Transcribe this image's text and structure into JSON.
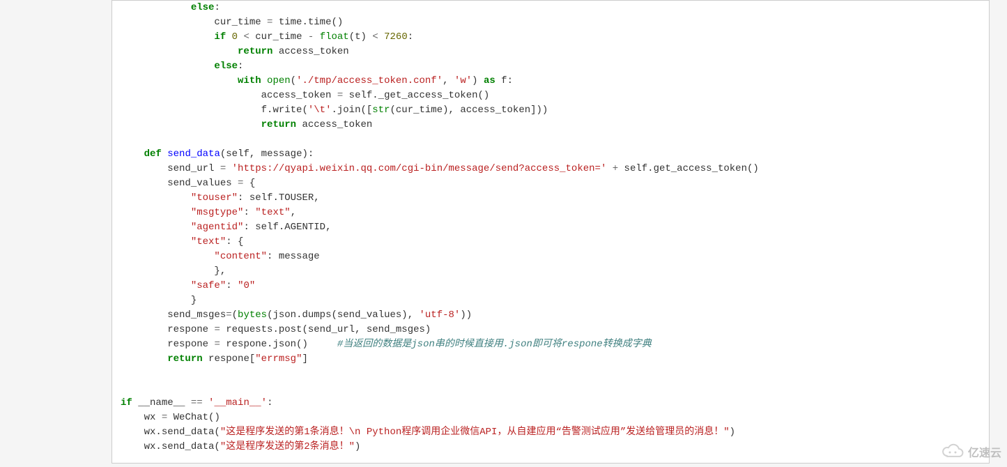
{
  "code": {
    "lines": [
      {
        "indent": 12,
        "segments": [
          {
            "t": "else",
            "c": "kw"
          },
          {
            "t": ":"
          }
        ]
      },
      {
        "indent": 16,
        "segments": [
          {
            "t": "cur_time "
          },
          {
            "t": "=",
            "c": "op"
          },
          {
            "t": " time.time()"
          }
        ]
      },
      {
        "indent": 16,
        "segments": [
          {
            "t": "if",
            "c": "kw"
          },
          {
            "t": " "
          },
          {
            "t": "0",
            "c": "num"
          },
          {
            "t": " "
          },
          {
            "t": "<",
            "c": "op"
          },
          {
            "t": " cur_time "
          },
          {
            "t": "-",
            "c": "op"
          },
          {
            "t": " "
          },
          {
            "t": "float",
            "c": "nm"
          },
          {
            "t": "(t) "
          },
          {
            "t": "<",
            "c": "op"
          },
          {
            "t": " "
          },
          {
            "t": "7260",
            "c": "num"
          },
          {
            "t": ":"
          }
        ]
      },
      {
        "indent": 20,
        "segments": [
          {
            "t": "return",
            "c": "kw"
          },
          {
            "t": " access_token"
          }
        ]
      },
      {
        "indent": 16,
        "segments": [
          {
            "t": "else",
            "c": "kw"
          },
          {
            "t": ":"
          }
        ]
      },
      {
        "indent": 20,
        "segments": [
          {
            "t": "with",
            "c": "kw"
          },
          {
            "t": " "
          },
          {
            "t": "open",
            "c": "nm"
          },
          {
            "t": "("
          },
          {
            "t": "'./tmp/access_token.conf'",
            "c": "strb"
          },
          {
            "t": ", "
          },
          {
            "t": "'w'",
            "c": "strb"
          },
          {
            "t": ") "
          },
          {
            "t": "as",
            "c": "kw"
          },
          {
            "t": " f:"
          }
        ]
      },
      {
        "indent": 24,
        "segments": [
          {
            "t": "access_token "
          },
          {
            "t": "=",
            "c": "op"
          },
          {
            "t": " self._get_access_token()"
          }
        ]
      },
      {
        "indent": 24,
        "segments": [
          {
            "t": "f.write("
          },
          {
            "t": "'\\t'",
            "c": "strb"
          },
          {
            "t": ".join(["
          },
          {
            "t": "str",
            "c": "nm"
          },
          {
            "t": "(cur_time), access_token]))"
          }
        ]
      },
      {
        "indent": 24,
        "segments": [
          {
            "t": "return",
            "c": "kw"
          },
          {
            "t": " access_token"
          }
        ]
      },
      {
        "indent": 0,
        "segments": []
      },
      {
        "indent": 4,
        "segments": [
          {
            "t": "def",
            "c": "kw"
          },
          {
            "t": " "
          },
          {
            "t": "send_data",
            "c": "fn"
          },
          {
            "t": "(self, message):"
          }
        ]
      },
      {
        "indent": 8,
        "segments": [
          {
            "t": "send_url "
          },
          {
            "t": "=",
            "c": "op"
          },
          {
            "t": " "
          },
          {
            "t": "'https://qyapi.weixin.qq.com/cgi-bin/message/send?access_token='",
            "c": "strb"
          },
          {
            "t": " "
          },
          {
            "t": "+",
            "c": "op"
          },
          {
            "t": " self.get_access_token()"
          }
        ]
      },
      {
        "indent": 8,
        "segments": [
          {
            "t": "send_values "
          },
          {
            "t": "=",
            "c": "op"
          },
          {
            "t": " {"
          }
        ]
      },
      {
        "indent": 12,
        "segments": [
          {
            "t": "\"touser\"",
            "c": "strb"
          },
          {
            "t": ": self.TOUSER,"
          }
        ]
      },
      {
        "indent": 12,
        "segments": [
          {
            "t": "\"msgtype\"",
            "c": "strb"
          },
          {
            "t": ": "
          },
          {
            "t": "\"text\"",
            "c": "strb"
          },
          {
            "t": ","
          }
        ]
      },
      {
        "indent": 12,
        "segments": [
          {
            "t": "\"agentid\"",
            "c": "strb"
          },
          {
            "t": ": self.AGENTID,"
          }
        ]
      },
      {
        "indent": 12,
        "segments": [
          {
            "t": "\"text\"",
            "c": "strb"
          },
          {
            "t": ": {"
          }
        ]
      },
      {
        "indent": 16,
        "segments": [
          {
            "t": "\"content\"",
            "c": "strb"
          },
          {
            "t": ": message"
          }
        ]
      },
      {
        "indent": 16,
        "segments": [
          {
            "t": "},"
          }
        ]
      },
      {
        "indent": 12,
        "segments": [
          {
            "t": "\"safe\"",
            "c": "strb"
          },
          {
            "t": ": "
          },
          {
            "t": "\"0\"",
            "c": "strb"
          }
        ]
      },
      {
        "indent": 12,
        "segments": [
          {
            "t": "}"
          }
        ]
      },
      {
        "indent": 8,
        "segments": [
          {
            "t": "send_msges"
          },
          {
            "t": "=",
            "c": "op"
          },
          {
            "t": "("
          },
          {
            "t": "bytes",
            "c": "nm"
          },
          {
            "t": "(json.dumps(send_values), "
          },
          {
            "t": "'utf-8'",
            "c": "strb"
          },
          {
            "t": "))"
          }
        ]
      },
      {
        "indent": 8,
        "segments": [
          {
            "t": "respone "
          },
          {
            "t": "=",
            "c": "op"
          },
          {
            "t": " requests.post(send_url, send_msges)"
          }
        ]
      },
      {
        "indent": 8,
        "segments": [
          {
            "t": "respone "
          },
          {
            "t": "=",
            "c": "op"
          },
          {
            "t": " respone.json()     "
          },
          {
            "t": "#当返回的数据是json串的时候直接用.json即可将respone转换成字典",
            "c": "com"
          }
        ]
      },
      {
        "indent": 8,
        "segments": [
          {
            "t": "return",
            "c": "kw"
          },
          {
            "t": " respone["
          },
          {
            "t": "\"errmsg\"",
            "c": "strb"
          },
          {
            "t": "]"
          }
        ]
      },
      {
        "indent": 0,
        "segments": []
      },
      {
        "indent": 0,
        "segments": []
      },
      {
        "indent": 0,
        "segments": [
          {
            "t": "if",
            "c": "kw"
          },
          {
            "t": " __name__ "
          },
          {
            "t": "==",
            "c": "op"
          },
          {
            "t": " "
          },
          {
            "t": "'__main__'",
            "c": "strb"
          },
          {
            "t": ":"
          }
        ]
      },
      {
        "indent": 4,
        "segments": [
          {
            "t": "wx "
          },
          {
            "t": "=",
            "c": "op"
          },
          {
            "t": " WeChat()"
          }
        ]
      },
      {
        "indent": 4,
        "segments": [
          {
            "t": "wx.send_data("
          },
          {
            "t": "\"这是程序发送的第1条消息！\\n Python程序调用企业微信API，从自建应用“告警测试应用”发送给管理员的消息！\"",
            "c": "strb"
          },
          {
            "t": ")"
          }
        ]
      },
      {
        "indent": 4,
        "segments": [
          {
            "t": "wx.send_data("
          },
          {
            "t": "\"这是程序发送的第2条消息！\"",
            "c": "strb"
          },
          {
            "t": ")"
          }
        ]
      }
    ]
  },
  "watermark": {
    "text": "亿速云"
  }
}
